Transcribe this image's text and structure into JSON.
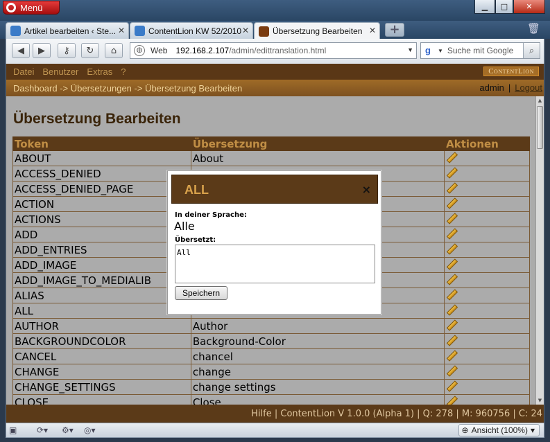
{
  "browser": {
    "menu_label": "Menü",
    "tabs": [
      {
        "label": "Artikel bearbeiten ‹ Ste..."
      },
      {
        "label": "ContentLion KW 52/2010"
      },
      {
        "label": "Übersetzung Bearbeiten"
      }
    ],
    "address": {
      "mode": "Web",
      "host": "192.168.2.107",
      "path": "/admin/edittranslation.html"
    },
    "search_placeholder": "Suche mit Google",
    "zoom_label": "Ansicht (100%)"
  },
  "app": {
    "menu": [
      "Datei",
      "Benutzer",
      "Extras",
      "?"
    ],
    "brand": "ContentLion",
    "breadcrumb": "Dashboard -> Übersetzungen -> Übersetzung Bearbeiten",
    "user": "admin",
    "separator": "|",
    "logout": "Logout",
    "page_title": "Übersetzung Bearbeiten"
  },
  "table": {
    "headers": [
      "Token",
      "Übersetzung",
      "Aktionen"
    ],
    "rows": [
      {
        "token": "ABOUT",
        "translation": "About"
      },
      {
        "token": "ACCESS_DENIED",
        "translation": ""
      },
      {
        "token": "ACCESS_DENIED_PAGE",
        "translation": ""
      },
      {
        "token": "ACTION",
        "translation": ""
      },
      {
        "token": "ACTIONS",
        "translation": ""
      },
      {
        "token": "ADD",
        "translation": ""
      },
      {
        "token": "ADD_ENTRIES",
        "translation": ""
      },
      {
        "token": "ADD_IMAGE",
        "translation": ""
      },
      {
        "token": "ADD_IMAGE_TO_MEDIALIB",
        "translation": ""
      },
      {
        "token": "ALIAS",
        "translation": ""
      },
      {
        "token": "ALL",
        "translation": ""
      },
      {
        "token": "AUTHOR",
        "translation": "Author"
      },
      {
        "token": "BACKGROUNDCOLOR",
        "translation": "Background-Color"
      },
      {
        "token": "CANCEL",
        "translation": "chancel"
      },
      {
        "token": "CHANGE",
        "translation": "change"
      },
      {
        "token": "CHANGE_SETTINGS",
        "translation": "change settings"
      },
      {
        "token": "CLOSE",
        "translation": "Close"
      }
    ]
  },
  "modal": {
    "title": "ALL",
    "close": "×",
    "source_label": "In deiner Sprache:",
    "source_value": "Alle",
    "translated_label": "Übersetzt:",
    "translated_value": "All",
    "save_label": "Speichern"
  },
  "statusbar": {
    "text": "Hilfe | ContentLion V 1.0.0 (Alpha 1) | Q: 278 | M: 960756 | C: 24"
  },
  "colors": {
    "app_dark_brown": "#5b3a18",
    "app_gold": "#c08e45",
    "crumb_orange": "#9f6b27",
    "page_gray": "#ababab"
  }
}
